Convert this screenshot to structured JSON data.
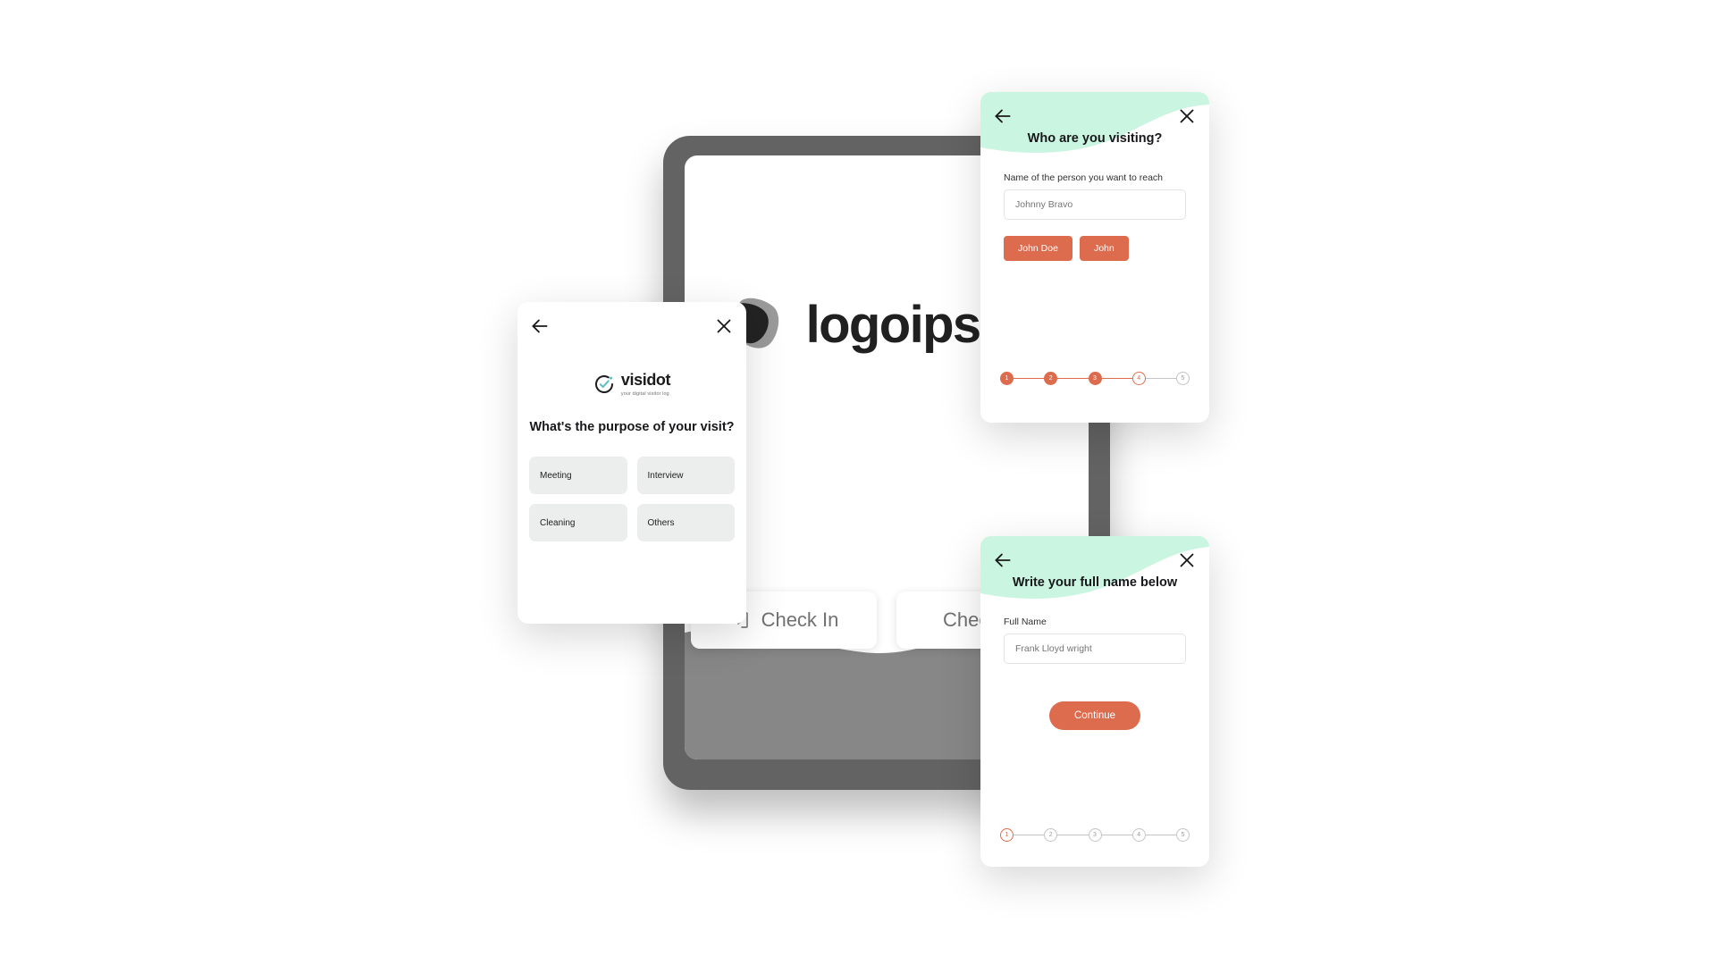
{
  "colors": {
    "accent_orange": "#dd6b4d",
    "mint_wave": "#c9f5e1",
    "device_bezel": "#636363",
    "device_wave_gray": "#878787",
    "option_bg": "#eceded",
    "step_inactive": "#c4c4c4",
    "brand_teal": "#5bbfc4",
    "page_bg": "#ffffff"
  },
  "kiosk": {
    "logo_text": "logoipsum",
    "logo_mark_name": "logoipsum-triangle-mark",
    "actions": [
      {
        "label": "Check In",
        "icon": "check-in-icon"
      },
      {
        "label": "Check Out",
        "icon": "check-out-icon"
      }
    ]
  },
  "purpose_card": {
    "back_icon": "arrow-left-icon",
    "close_icon": "close-icon",
    "brand": {
      "name": "visidot",
      "tagline": "your digital visitor log",
      "mark": "visidot-check-circle-icon"
    },
    "title": "What's the purpose of your visit?",
    "options": [
      {
        "label": "Meeting"
      },
      {
        "label": "Interview"
      },
      {
        "label": "Cleaning"
      },
      {
        "label": "Others"
      }
    ]
  },
  "visiting_card": {
    "back_icon": "arrow-left-icon",
    "close_icon": "close-icon",
    "title": "Who are you visiting?",
    "field": {
      "label": "Name of the person you want to reach",
      "value": "",
      "placeholder": "Johnny Bravo"
    },
    "suggestions": [
      {
        "label": "John Doe"
      },
      {
        "label": "John"
      }
    ],
    "stepper": {
      "total": 5,
      "current": 4,
      "steps": [
        {
          "number": "1",
          "state": "done"
        },
        {
          "number": "2",
          "state": "done"
        },
        {
          "number": "3",
          "state": "done"
        },
        {
          "number": "4",
          "state": "current"
        },
        {
          "number": "5",
          "state": "todo"
        }
      ]
    }
  },
  "name_card": {
    "back_icon": "arrow-left-icon",
    "close_icon": "close-icon",
    "title": "Write your full name below",
    "field": {
      "label": "Full Name",
      "value": "",
      "placeholder": "Frank Lloyd wright"
    },
    "continue_label": "Continue",
    "stepper": {
      "total": 5,
      "current": 1,
      "steps": [
        {
          "number": "1",
          "state": "current"
        },
        {
          "number": "2",
          "state": "todo"
        },
        {
          "number": "3",
          "state": "todo"
        },
        {
          "number": "4",
          "state": "todo"
        },
        {
          "number": "5",
          "state": "todo"
        }
      ]
    }
  }
}
